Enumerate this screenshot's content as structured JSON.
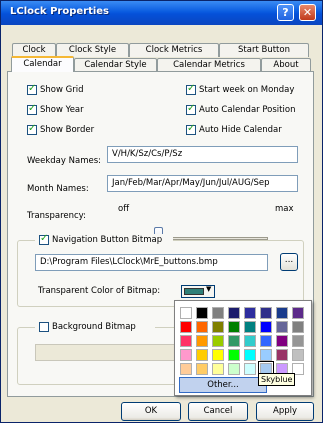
{
  "window": {
    "title": "LClock Properties",
    "help_glyph": "?",
    "close_glyph": "✕"
  },
  "tabs_back": [
    "Clock",
    "Clock Style",
    "Clock Metrics",
    "Start Button"
  ],
  "tabs_front": [
    "Calendar",
    "Calendar Style",
    "Calendar Metrics",
    "About"
  ],
  "options": {
    "show_grid": "Show Grid",
    "start_week_monday": "Start week on Monday",
    "show_year": "Show Year",
    "auto_calendar_position": "Auto Calendar Position",
    "show_border": "Show Border",
    "auto_hide_calendar": "Auto Hide Calendar"
  },
  "weekday_names": {
    "label": "Weekday Names:",
    "value": "V/H/K/Sz/Cs/P/Sz"
  },
  "month_names": {
    "label": "Month Names:",
    "value": "Jan/Feb/Mar/Apr/May/Jun/Jul/AUG/Sep"
  },
  "transparency": {
    "label": "Transparency:",
    "min_label": "off",
    "max_label": "max",
    "level": 0.05
  },
  "nav_bitmap": {
    "checkbox_label": "Navigation Button Bitmap",
    "path": "D:\\Program Files\\LClock\\MrE_buttons.bmp",
    "browse_label": "...",
    "transparent_color_label": "Transparent Color of Bitmap:",
    "selected_color": "#2f7f78"
  },
  "background_bitmap": {
    "checkbox_label": "Background Bitmap"
  },
  "color_popup": {
    "colors": [
      [
        "#ffffff",
        "#000000",
        "#808080",
        "#1c1c6c",
        "#2d2d9e",
        "#2f2f8a",
        "#1a3b8c",
        "#5c2a8a"
      ],
      [
        "#ff0000",
        "#ff6600",
        "#808000",
        "#008000",
        "#008080",
        "#0000ff",
        "#666699",
        "#808080"
      ],
      [
        "#ff3366",
        "#ff9900",
        "#99cc00",
        "#339966",
        "#33cccc",
        "#3366ff",
        "#800080",
        "#969696"
      ],
      [
        "#ff99cc",
        "#ffcc00",
        "#ffff00",
        "#00ff00",
        "#00ffff",
        "#99ccff",
        "#993366",
        "#c0c0c0"
      ],
      [
        "#ffcc99",
        "#ffcc66",
        "#ffff99",
        "#ccffcc",
        "#ccffff",
        "#a6caf0",
        "#cc99ff",
        "#ffffff"
      ]
    ],
    "other_label": "Other...",
    "tooltip": "Skyblue"
  },
  "buttons": {
    "ok": "OK",
    "cancel": "Cancel",
    "apply": "Apply"
  }
}
